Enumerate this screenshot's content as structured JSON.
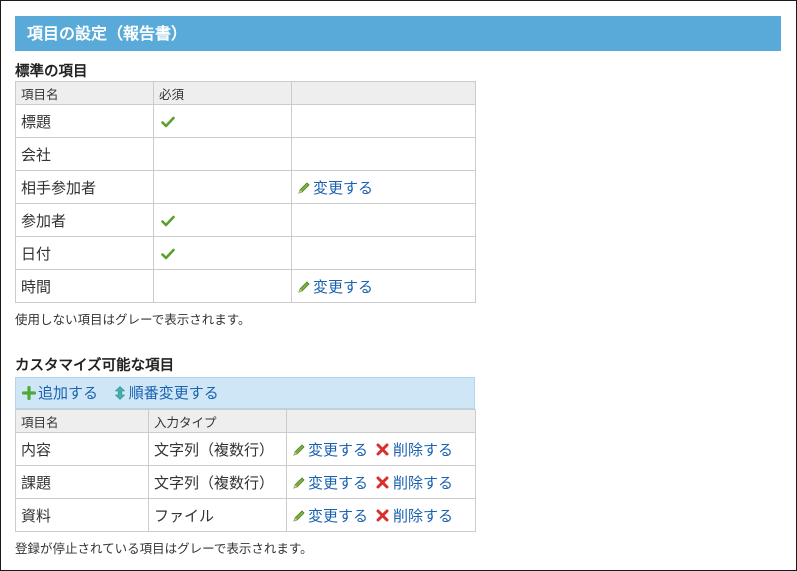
{
  "header": {
    "title": "項目の設定（報告書）"
  },
  "standard": {
    "title": "標準の項目",
    "columns": [
      "項目名",
      "必須",
      ""
    ],
    "rows": [
      {
        "name": "標題",
        "required": true,
        "action": ""
      },
      {
        "name": "会社",
        "required": false,
        "action": ""
      },
      {
        "name": "相手参加者",
        "required": false,
        "action": "変更する"
      },
      {
        "name": "参加者",
        "required": true,
        "action": ""
      },
      {
        "name": "日付",
        "required": true,
        "action": ""
      },
      {
        "name": "時間",
        "required": false,
        "action": "変更する"
      }
    ],
    "note": "使用しない項目はグレーで表示されます。"
  },
  "custom": {
    "title": "カスタマイズ可能な項目",
    "toolbar": {
      "add_label": "追加する",
      "reorder_label": "順番変更する"
    },
    "columns": [
      "項目名",
      "入力タイプ",
      ""
    ],
    "rows": [
      {
        "name": "内容",
        "type": "文字列（複数行）",
        "edit": "変更する",
        "delete": "削除する"
      },
      {
        "name": "課題",
        "type": "文字列（複数行）",
        "edit": "変更する",
        "delete": "削除する"
      },
      {
        "name": "資料",
        "type": "ファイル",
        "edit": "変更する",
        "delete": "削除する"
      }
    ],
    "note": "登録が停止されている項目はグレーで表示されます。"
  },
  "colors": {
    "header_bg": "#5aaad9",
    "toolbar_bg": "#cfe6f6",
    "link": "#1a62b0",
    "check": "#5aa02c",
    "delete_icon": "#d9302c"
  }
}
